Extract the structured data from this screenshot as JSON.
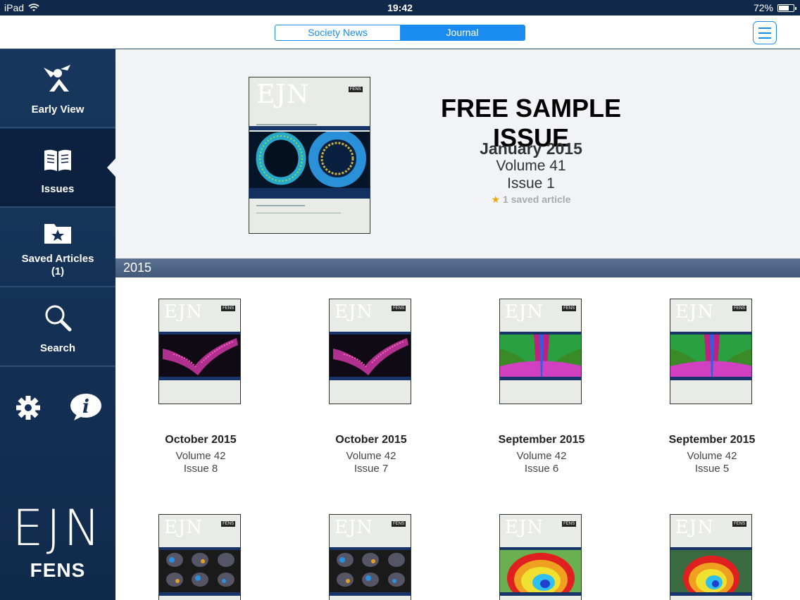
{
  "status": {
    "device": "iPad",
    "time": "19:42",
    "battery": "72%",
    "battery_level": 0.72
  },
  "nav": {
    "segments": [
      "Society News",
      "Journal"
    ],
    "active": "Journal"
  },
  "sidebar": {
    "items": [
      {
        "label": "Early View"
      },
      {
        "label": "Issues"
      },
      {
        "label": "Saved Articles",
        "count": "(1)"
      },
      {
        "label": "Search"
      }
    ],
    "brand": {
      "logo": "EJN",
      "sub": "FENS"
    }
  },
  "featured": {
    "title": "FREE SAMPLE ISSUE",
    "date": "January 2015",
    "volume": "Volume 41",
    "issue": "Issue 1",
    "saved": "1 saved article",
    "cover_text": "EJN"
  },
  "year": "2015",
  "issues": [
    {
      "date": "October 2015",
      "volume": "Volume 42",
      "issue": "Issue 8",
      "cover_text": "EJN"
    },
    {
      "date": "October 2015",
      "volume": "Volume 42",
      "issue": "Issue 7",
      "cover_text": "EJN"
    },
    {
      "date": "September 2015",
      "volume": "Volume 42",
      "issue": "Issue 6",
      "cover_text": "EJN"
    },
    {
      "date": "September 2015",
      "volume": "Volume 42",
      "issue": "Issue 5",
      "cover_text": "EJN"
    },
    {
      "cover_text": "EJN"
    },
    {
      "cover_text": "EJN"
    },
    {
      "cover_text": "EJN"
    },
    {
      "cover_text": "EJN"
    }
  ],
  "colors": {
    "accent": "#1a8cf0",
    "sidebar": "#14305a",
    "cover_band": "#17346b",
    "star": "#f0a800"
  },
  "icons": {
    "early_view": "flying-article-icon",
    "issues": "open-book-icon",
    "saved": "star-folder-icon",
    "search": "magnifier-icon",
    "settings": "gear-icon",
    "info": "info-bubble-icon",
    "menu": "hamburger-menu-icon",
    "wifi": "wifi-icon"
  }
}
